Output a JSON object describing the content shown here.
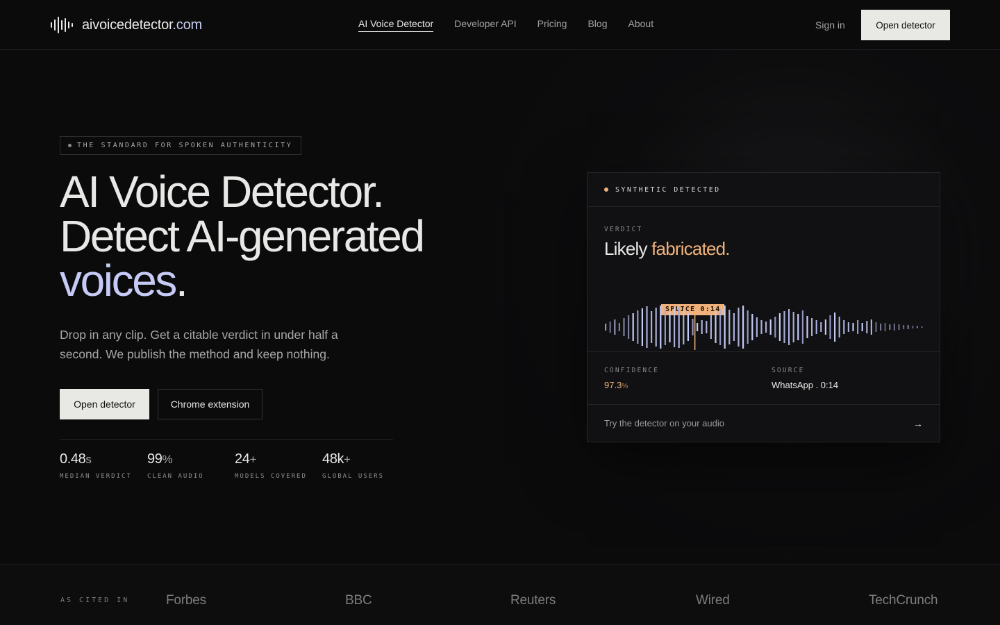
{
  "nav": {
    "brand_name": "aivoicedetector",
    "brand_tld": ".com",
    "links": [
      {
        "label": "AI Voice Detector",
        "active": true
      },
      {
        "label": "Developer API",
        "active": false
      },
      {
        "label": "Pricing",
        "active": false
      },
      {
        "label": "Blog",
        "active": false
      },
      {
        "label": "About",
        "active": false
      }
    ],
    "signin_label": "Sign in",
    "cta_label": "Open detector"
  },
  "hero": {
    "eyebrow": "THE STANDARD FOR SPOKEN AUTHENTICITY",
    "headline_line1": "AI Voice Detector.",
    "headline_line2": "Detect AI-generated",
    "headline_accent": "voices",
    "headline_period": ".",
    "subcopy": "Drop in any clip. Get a citable verdict in under half a second. We publish the method and keep nothing.",
    "primary_button": "Open detector",
    "secondary_button": "Chrome extension",
    "stats": [
      {
        "value": "0.48",
        "unit": "s",
        "label": "MEDIAN VERDICT"
      },
      {
        "value": "99",
        "unit": "%",
        "label": "CLEAN AUDIO"
      },
      {
        "value": "24",
        "unit": "+",
        "label": "MODELS COVERED"
      },
      {
        "value": "48k",
        "unit": "+",
        "label": "GLOBAL USERS"
      }
    ]
  },
  "card": {
    "status": "SYNTHETIC DETECTED",
    "verdict_label": "VERDICT",
    "verdict_prefix": "Likely",
    "verdict_word": "fabricated.",
    "splice_tag": "SPLICE 0:14",
    "confidence_label": "CONFIDENCE",
    "confidence_value": "97.3",
    "confidence_unit": "%",
    "source_label": "SOURCE",
    "source_value": "WhatsApp . 0:14",
    "footer_text": "Try the detector on your audio",
    "footer_arrow": "→"
  },
  "cited": {
    "label": "AS CITED IN",
    "outlets": [
      "Forbes",
      "BBC",
      "Reuters",
      "Wired",
      "TechCrunch"
    ]
  },
  "colors": {
    "background": "#0b0b0c",
    "accent_lavender": "#c6cbf6",
    "accent_amber": "#f0b27a",
    "button_light": "#e8e8e4"
  }
}
